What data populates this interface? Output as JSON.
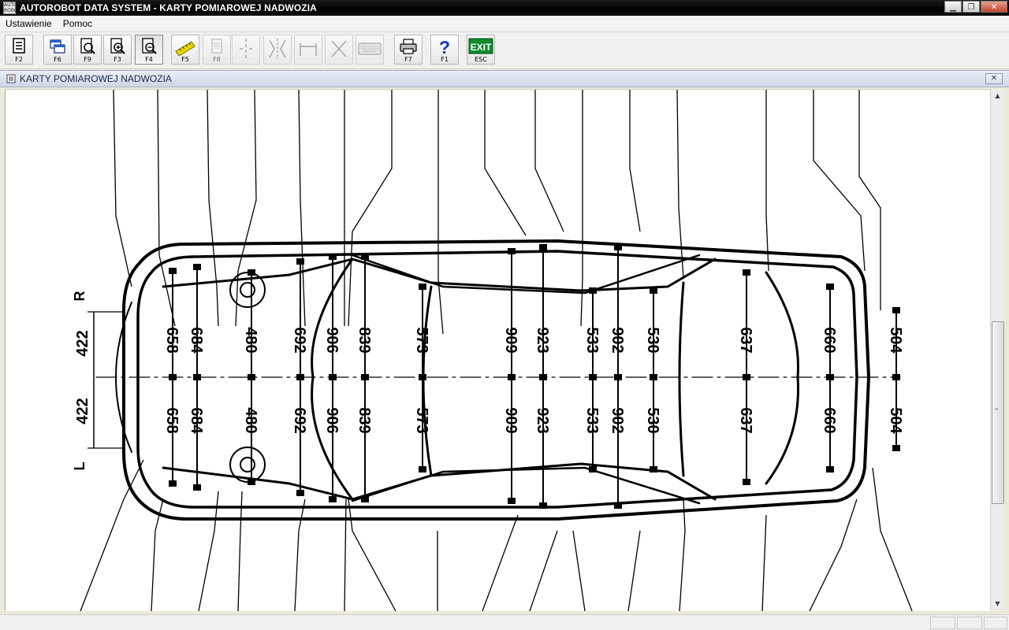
{
  "window": {
    "title": "AUTOROBOT DATA SYSTEM - KARTY POMIAROWEJ NADWOZIA",
    "icon_text_top": "AUTO",
    "icon_text_bottom": "ROBOT"
  },
  "menu": {
    "items": [
      "Ustawienie",
      "Pomoc"
    ]
  },
  "toolbar": {
    "buttons": [
      {
        "key": "F2",
        "icon": "save-card-icon"
      },
      {
        "key": "F6",
        "icon": "windows-icon"
      },
      {
        "key": "F9",
        "icon": "preview-icon"
      },
      {
        "key": "F3",
        "icon": "zoom-in-icon"
      },
      {
        "key": "F4",
        "icon": "zoom-out-icon"
      },
      {
        "key": "F5",
        "icon": "ruler-icon"
      },
      {
        "key": "F8",
        "icon": "sheet-icon"
      },
      {
        "key": "",
        "icon": "center-line-icon"
      },
      {
        "key": "",
        "icon": "mirror-icon"
      },
      {
        "key": "",
        "icon": "width-icon"
      },
      {
        "key": "",
        "icon": "cross-icon"
      },
      {
        "key": "",
        "icon": "keyboard-icon"
      },
      {
        "key": "F7",
        "icon": "printer-icon"
      },
      {
        "key": "F1",
        "icon": "help-icon"
      },
      {
        "key": "ESC",
        "icon": "exit-icon",
        "label": "EXIT"
      }
    ]
  },
  "child_window": {
    "title": "KARTY POMIAROWEJ NADWOZIA"
  },
  "diagram": {
    "side_labels": {
      "right": "R",
      "left": "L"
    },
    "offset_top": "422",
    "offset_bottom": "422",
    "measurements": [
      "658",
      "684",
      "480",
      "692",
      "906",
      "839",
      "573",
      "909",
      "923",
      "533",
      "902",
      "530",
      "637",
      "660",
      "504"
    ]
  },
  "colors": {
    "titlebar": "#000000",
    "title_text": "#ffffff",
    "drawing": "#000000"
  }
}
